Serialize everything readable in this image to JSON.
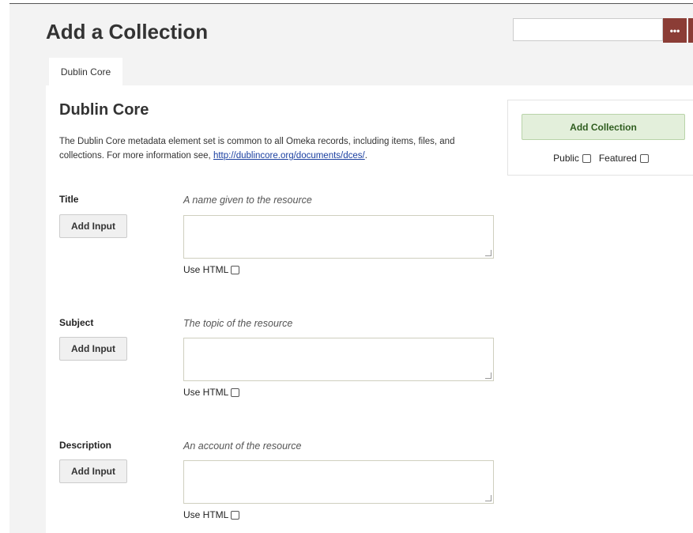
{
  "header": {
    "page_title": "Add a Collection",
    "search": {
      "value": "",
      "placeholder": "",
      "options_label": "•••"
    }
  },
  "tabs": [
    {
      "label": "Dublin Core",
      "active": true
    }
  ],
  "section": {
    "title": "Dublin Core",
    "description_text": "The Dublin Core metadata element set is common to all Omeka records, including items, files, and collections. For more information see, ",
    "description_link": "http://dublincore.org/documents/dces/",
    "description_end": "."
  },
  "fields": [
    {
      "label": "Title",
      "hint": "A name given to the resource",
      "add_input_label": "Add Input",
      "use_html_label": "Use HTML",
      "value": ""
    },
    {
      "label": "Subject",
      "hint": "The topic of the resource",
      "add_input_label": "Add Input",
      "use_html_label": "Use HTML",
      "value": ""
    },
    {
      "label": "Description",
      "hint": "An account of the resource",
      "add_input_label": "Add Input",
      "use_html_label": "Use HTML",
      "value": ""
    }
  ],
  "sidebar": {
    "submit_label": "Add Collection",
    "public_label": "Public",
    "featured_label": "Featured"
  },
  "colors": {
    "brand_button": "#8b3d36",
    "submit_background": "#e3efdb",
    "submit_text": "#2f5d1f",
    "link": "#1a3fa0"
  },
  "icons": {
    "search_options": "ellipsis-icon",
    "resize": "resize-grip-icon"
  }
}
